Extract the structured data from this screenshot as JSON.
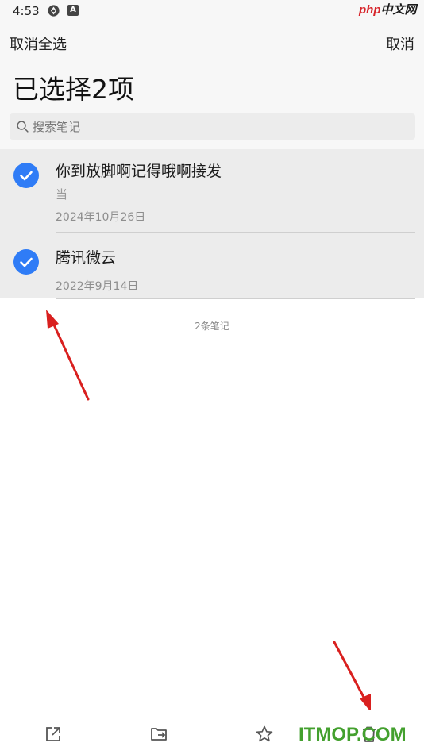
{
  "status_bar": {
    "time": "4:53",
    "icons": [
      "sync-icon",
      "a-notification-icon"
    ]
  },
  "watermark_top": {
    "php": "php",
    "cn": "中文网"
  },
  "header": {
    "deselect_all_label": "取消全选",
    "cancel_label": "取消",
    "title": "已选择2项"
  },
  "search": {
    "placeholder": "搜索笔记",
    "value": ""
  },
  "notes": [
    {
      "title": "你到放脚啊记得哦啊接发",
      "snippet": "当",
      "date": "2024年10月26日",
      "selected": true
    },
    {
      "title": "腾讯微云",
      "snippet": "",
      "date": "2022年9月14日",
      "selected": true
    }
  ],
  "note_count": "2条笔记",
  "toolbar": {
    "items": [
      "share-icon",
      "move-to-folder-icon",
      "star-icon",
      "delete-icon"
    ]
  },
  "watermark_bottom": "ITMOP.COM",
  "colors": {
    "accent": "#2f7cf6",
    "arrow": "#d9201f",
    "selected_bg": "#ececec",
    "watermark_green": "#43a02e"
  }
}
